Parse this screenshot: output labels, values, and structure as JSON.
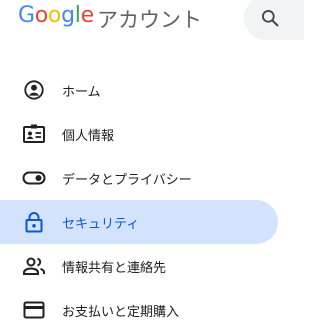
{
  "header": {
    "logo_letters": [
      {
        "char": "G",
        "color": "#4285F4"
      },
      {
        "char": "o",
        "color": "#EA4335"
      },
      {
        "char": "o",
        "color": "#FBBC05"
      },
      {
        "char": "g",
        "color": "#4285F4"
      },
      {
        "char": "l",
        "color": "#34A853"
      },
      {
        "char": "e",
        "color": "#EA4335"
      }
    ],
    "product_name": "アカウント",
    "search_icon": "search-icon"
  },
  "nav": {
    "items": [
      {
        "label": "ホーム",
        "icon": "account-circle-icon"
      },
      {
        "label": "個人情報",
        "icon": "badge-icon"
      },
      {
        "label": "データとプライバシー",
        "icon": "toggle-icon"
      },
      {
        "label": "セキュリティ",
        "icon": "lock-icon",
        "active": true
      },
      {
        "label": "情報共有と連絡先",
        "icon": "people-icon"
      },
      {
        "label": "お支払いと定期購入",
        "icon": "credit-card-icon"
      }
    ],
    "active_color": "#0b57d0",
    "active_bg": "#d3e3fd"
  }
}
